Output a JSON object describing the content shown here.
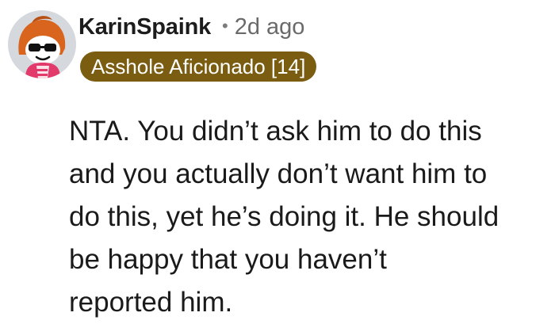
{
  "comment": {
    "author": "KarinSpaink",
    "separator": "•",
    "timestamp": "2d ago",
    "flair": "Asshole Aficionado [14]",
    "avatar_icon": "snoo-avatar-icon",
    "body_lines": [
      "NTA. You didn’t ask him to do this",
      "and you actually don’t want him to",
      "do this, yet he’s doing it. He should",
      "be happy that you haven’t",
      "reported him."
    ]
  },
  "colors": {
    "flair_bg": "#7b5d11",
    "avatar_bg": "#d5d9de",
    "avatar_hood": "#d9641e"
  }
}
